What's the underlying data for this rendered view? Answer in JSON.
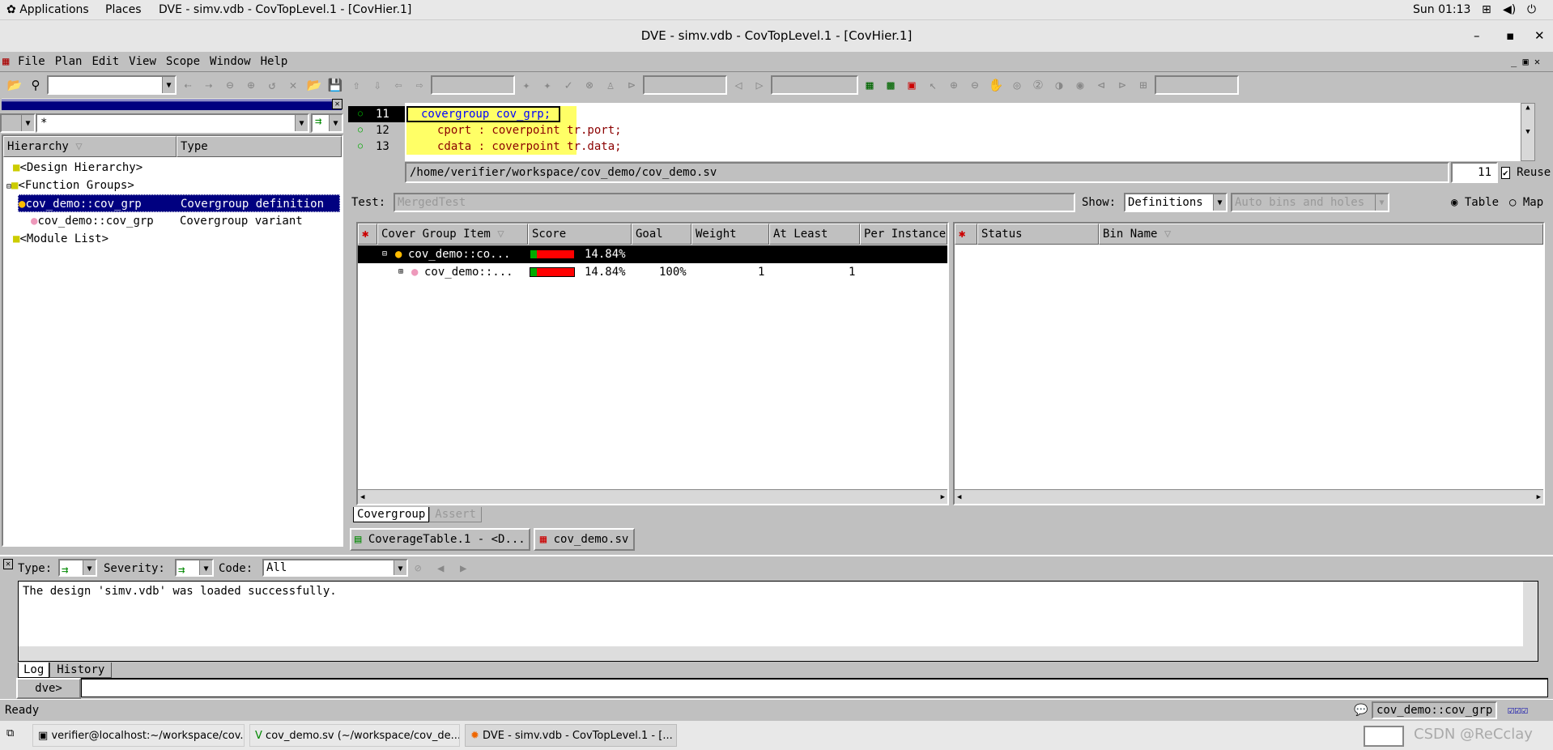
{
  "os_bar": {
    "applications": "Applications",
    "places": "Places",
    "active_app": "DVE - simv.vdb -  CovTopLevel.1 - [CovHier.1]",
    "clock": "Sun 01:13"
  },
  "window": {
    "title": "DVE - simv.vdb -  CovTopLevel.1 - [CovHier.1]"
  },
  "menu": [
    "File",
    "Plan",
    "Edit",
    "View",
    "Scope",
    "Window",
    "Help"
  ],
  "hier_panel": {
    "filter": "*",
    "columns": [
      "Hierarchy",
      "Type"
    ],
    "rows": [
      {
        "name": "<Design Hierarchy>",
        "type": ""
      },
      {
        "name": "<Function Groups>",
        "type": ""
      },
      {
        "name": "cov_demo::cov_grp",
        "type": "Covergroup definition",
        "selected": true
      },
      {
        "name": "cov_demo::cov_grp",
        "type": "Covergroup variant"
      },
      {
        "name": "<Module List>",
        "type": ""
      }
    ]
  },
  "source": {
    "lines": [
      {
        "num": "11",
        "code": "covergroup cov_grp;"
      },
      {
        "num": "12",
        "code": "cport : coverpoint tr.port;"
      },
      {
        "num": "13",
        "code": "cdata : coverpoint tr.data;"
      }
    ],
    "path": "/home/verifier/workspace/cov_demo/cov_demo.sv",
    "line_field": "11",
    "reuse_label": "Reuse",
    "reuse_checked": true
  },
  "coverage": {
    "test_label": "Test:",
    "test_value": "MergedTest",
    "show_label": "Show:",
    "show_value": "Definitions",
    "bins_value": "Auto bins and holes",
    "view_table": "Table",
    "view_map": "Map",
    "view_selected": "Table",
    "columns": [
      "Cover Group Item",
      "Score",
      "Goal",
      "Weight",
      "At Least",
      "Per Instance"
    ],
    "rows": [
      {
        "item": "cov_demo::co...",
        "score": "14.84%",
        "score_fraction": 0.1484,
        "goal": "",
        "weight": "",
        "at_least": "",
        "per_instance": "",
        "selected": true
      },
      {
        "item": "cov_demo::...",
        "score": "14.84%",
        "score_fraction": 0.1484,
        "goal": "100%",
        "weight": "1",
        "at_least": "1",
        "per_instance": ""
      }
    ],
    "bin_columns": [
      "Status",
      "Bin Name"
    ],
    "tabs": [
      "Covergroup",
      "Assert"
    ]
  },
  "doc_tabs": [
    "CoverageTable.1 - <D...",
    "cov_demo.sv"
  ],
  "console": {
    "type_label": "Type:",
    "severity_label": "Severity:",
    "code_label": "Code:",
    "code_value": "All",
    "message": "The design 'simv.vdb' was loaded successfully.",
    "tabs": [
      "Log",
      "History"
    ],
    "prompt": "dve>"
  },
  "status": {
    "text": "Ready",
    "scope": "cov_demo::cov_grp"
  },
  "taskbar": [
    "verifier@localhost:~/workspace/cov...",
    "cov_demo.sv (~/workspace/cov_de...",
    "DVE - simv.vdb -  CovTopLevel.1 - [..."
  ],
  "watermark": "CSDN @ReCclay",
  "colors": {
    "selection": "#000080",
    "code_highlight": "#ffff66",
    "keyword": "#0000ff",
    "identifier": "#8b0000",
    "score_fill": "#00aa00",
    "score_empty": "#ff0000"
  }
}
